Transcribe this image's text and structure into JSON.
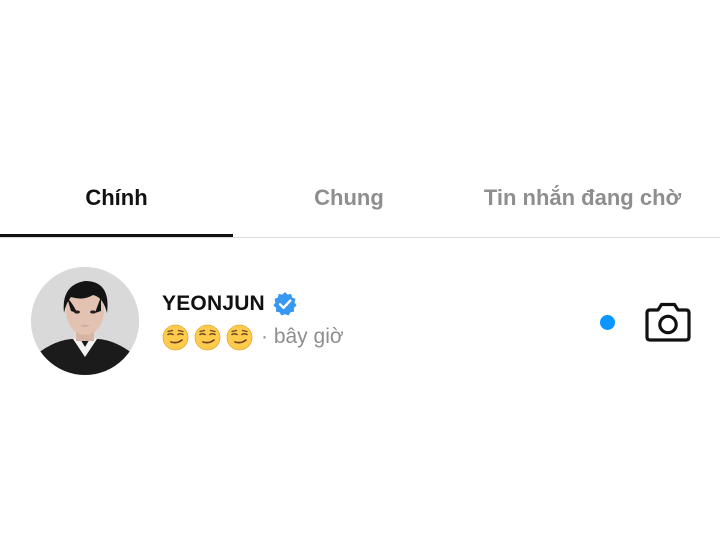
{
  "tabs": [
    {
      "label": "Chính",
      "active": true
    },
    {
      "label": "Chung",
      "active": false
    },
    {
      "label": "Tin nhắn đang chờ",
      "active": false
    }
  ],
  "thread": {
    "username": "YEONJUN",
    "verified": true,
    "preview_emoji": [
      "smirking-face",
      "smirking-face",
      "smirking-face"
    ],
    "timestamp": "· bây giờ",
    "unread": true,
    "camera_icon": "camera-icon",
    "avatar_icon": "profile-photo"
  },
  "colors": {
    "active_tab": "#111111",
    "inactive_tab": "#8e8e8e",
    "divider": "#dbdbdb",
    "verified_badge": "#3897f0",
    "unread_dot": "#0a95ff"
  }
}
